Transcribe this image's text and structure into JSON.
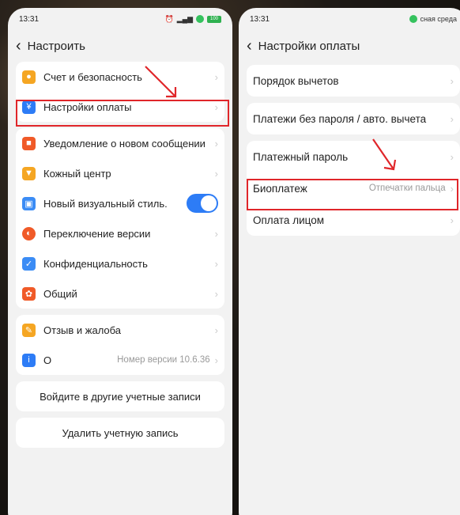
{
  "left": {
    "status": {
      "time": "13:31",
      "battery": "100"
    },
    "title": "Настроить",
    "group1": [
      {
        "icon": "account-icon",
        "color": "#f5a623",
        "label": "Счет и безопасность"
      },
      {
        "icon": "payment-icon",
        "color": "#2d7cf6",
        "label": "Настройки оплаты"
      }
    ],
    "group2": [
      {
        "icon": "message-icon",
        "color": "#f05a28",
        "label": "Уведомление о новом сообщении"
      },
      {
        "icon": "skin-icon",
        "color": "#f5a623",
        "label": "Кожный центр"
      },
      {
        "icon": "visual-style-icon",
        "color": "#3b8cf5",
        "label": "Новый визуальный стиль."
      },
      {
        "icon": "version-switch-icon",
        "color": "#f05a28",
        "label": "Переключение версии"
      },
      {
        "icon": "privacy-icon",
        "color": "#3b8cf5",
        "label": "Конфиденциальность"
      },
      {
        "icon": "general-icon",
        "color": "#f05a28",
        "label": "Общий"
      }
    ],
    "group3": [
      {
        "icon": "feedback-icon",
        "color": "#f5a623",
        "label": "Отзыв и жалоба"
      },
      {
        "icon": "info-icon",
        "color": "#2d7cf6",
        "label": "О",
        "value": "Номер версии 10.6.36"
      }
    ],
    "login_other": "Войдите в другие учетные записи",
    "delete_account": "Удалить учетную запись"
  },
  "right": {
    "status": {
      "time": "13:31",
      "env": "сная среда"
    },
    "title": "Настройки оплаты",
    "group1": [
      {
        "label": "Порядок вычетов"
      }
    ],
    "group2": [
      {
        "label": "Платежи без пароля / авто. вычета"
      }
    ],
    "group3": [
      {
        "label": "Платежный пароль"
      },
      {
        "label": "Биоплатеж",
        "value": "Отпечатки пальца"
      },
      {
        "label": "Оплата лицом"
      }
    ]
  },
  "annotation_color": "#e0262a"
}
